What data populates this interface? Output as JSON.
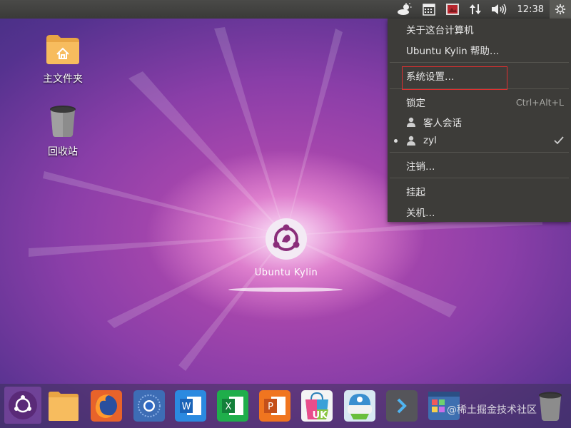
{
  "desktop": {
    "home_folder_label": "主文件夹",
    "trash_label": "回收站",
    "logo_text": "Ubuntu Kylin"
  },
  "top_panel": {
    "clock": "12:38",
    "icons": [
      "weather-icon",
      "calendar-icon",
      "screenshot-icon",
      "network-icon",
      "volume-icon",
      "gear-icon"
    ]
  },
  "session_menu": {
    "about": "关于这台计算机",
    "help": "Ubuntu Kylin 帮助…",
    "settings": "系统设置…",
    "lock": "锁定",
    "lock_shortcut": "Ctrl+Alt+L",
    "guest": "客人会话",
    "current_user": "zyl",
    "logout": "注销…",
    "suspend": "挂起",
    "shutdown": "关机…"
  },
  "dock": {
    "items": [
      "ubuntu-kylin",
      "files",
      "firefox",
      "chromium",
      "wps-writer",
      "wps-spreadsheets",
      "wps-presentation",
      "software-center",
      "kylin-assistant",
      "terminal",
      "settings",
      "trash"
    ],
    "uk_badge": "UK"
  },
  "watermark": "@稀土掘金技术社区",
  "colors": {
    "panel": "#3a3a38",
    "menu_bg": "#3d3c39",
    "highlight_border": "#e03030",
    "folder": "#f5b55a"
  }
}
